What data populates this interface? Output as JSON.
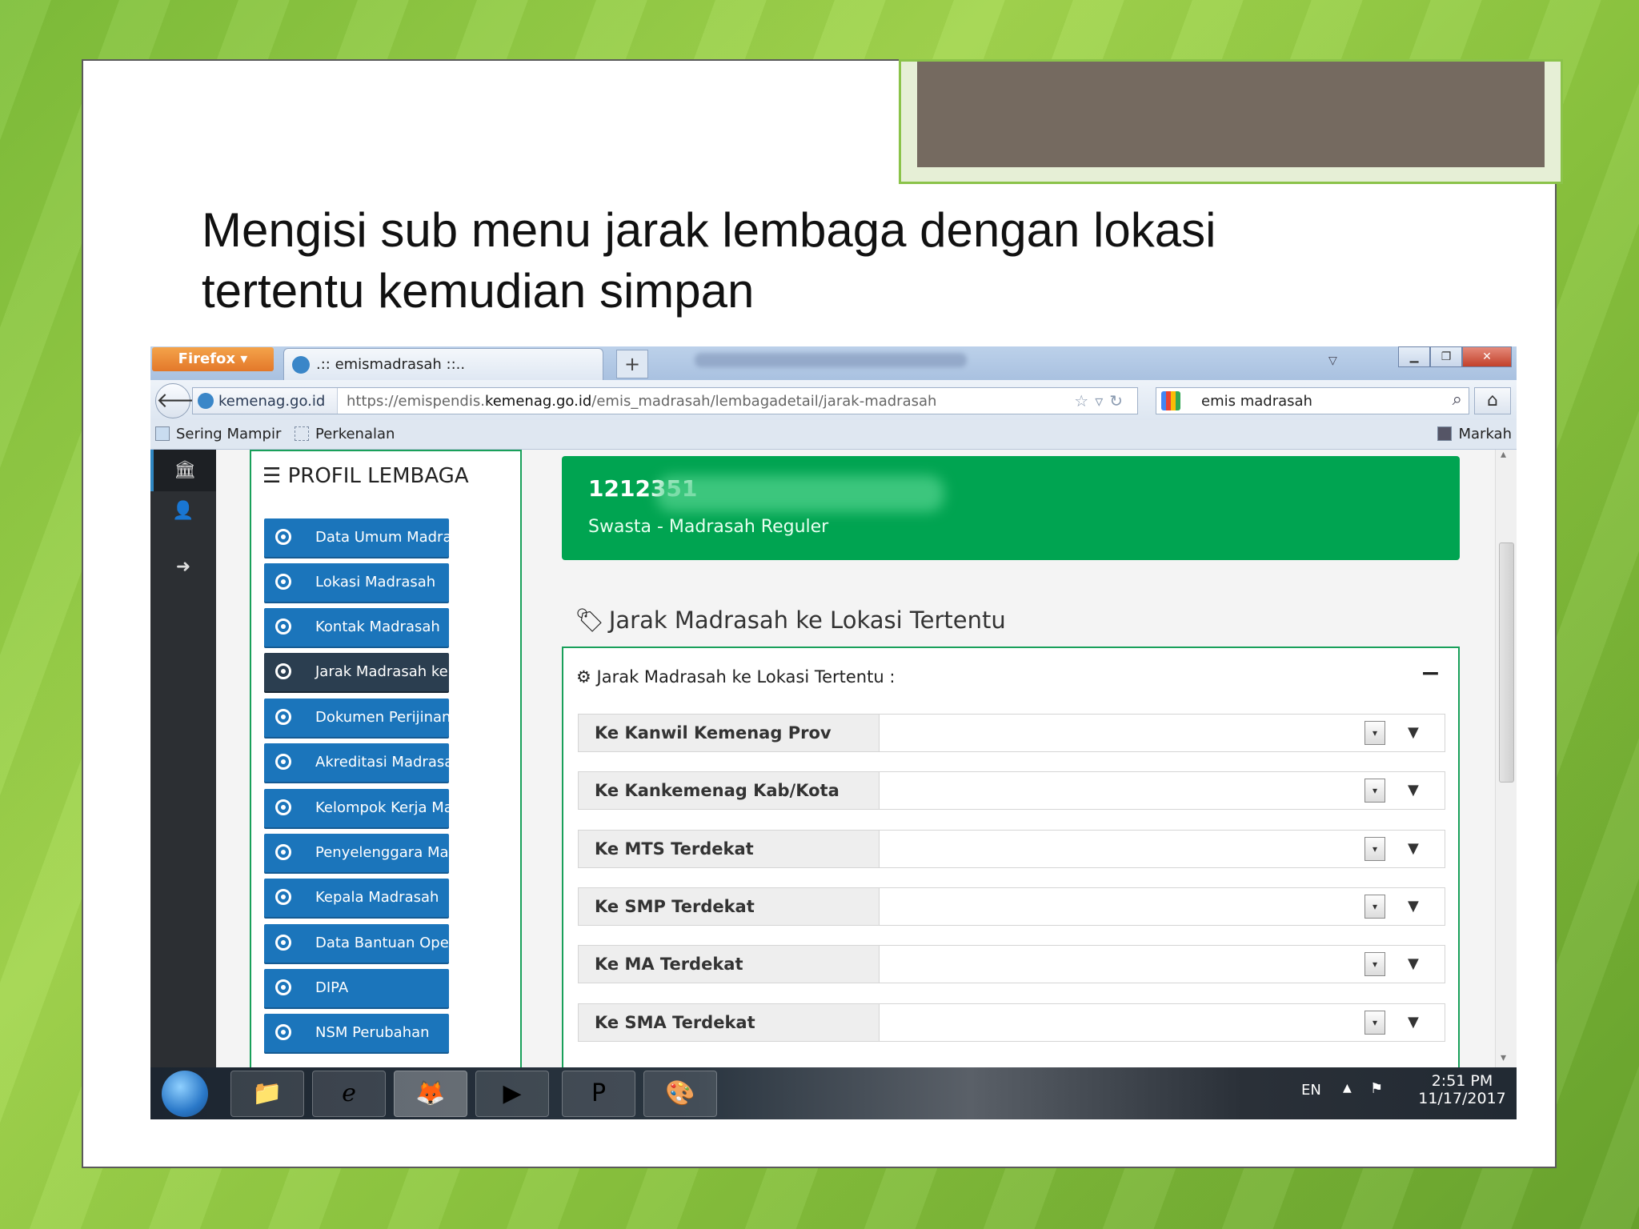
{
  "slide": {
    "heading_line1": "Mengisi sub menu jarak lembaga dengan lokasi",
    "heading_line2": "tertentu kemudian simpan"
  },
  "browser": {
    "firefox_menu": "Firefox",
    "tab_title": ".:: emismadrasah ::..",
    "new_tab": "+",
    "site_name": "kemenag.go.id",
    "url_prefix": "https://emispendis.",
    "url_domain": "kemenag.go.id",
    "url_path": "/emis_madrasah/lembagadetail/jarak-madrasah",
    "search_value": "emis madrasah",
    "bookmarks": [
      "Sering Mampir",
      "Perkenalan"
    ],
    "bookmarks_right": "Markah"
  },
  "sidebar_icons": [
    "bank-icon",
    "user-icon",
    "logout-icon"
  ],
  "profil": {
    "title": "PROFIL LEMBAGA",
    "menu": [
      "Data Umum Madrasah",
      "Lokasi Madrasah",
      "Kontak Madrasah",
      "Jarak Madrasah ke Lo...",
      "Dokumen Perijinan & ...",
      "Akreditasi Madrasah",
      "Kelompok Kerja Madr...",
      "Penyelenggara Madra...",
      "Kepala Madrasah",
      "Data Bantuan Operasi...",
      "DIPA",
      "NSM Perubahan"
    ],
    "active_index": 3
  },
  "institution": {
    "id": "1212351",
    "type": "Swasta - Madrasah Reguler"
  },
  "section": {
    "title": "Jarak Madrasah ke Lokasi Tertentu",
    "panel_title": "Jarak Madrasah ke Lokasi Tertentu :",
    "collapse": "−",
    "fields": [
      {
        "label": "Ke Kanwil Kemenag Prov",
        "value": ""
      },
      {
        "label": "Ke Kankemenag Kab/Kota",
        "value": ""
      },
      {
        "label": "Ke MTS Terdekat",
        "value": ""
      },
      {
        "label": "Ke SMP Terdekat",
        "value": ""
      },
      {
        "label": "Ke MA Terdekat",
        "value": ""
      },
      {
        "label": "Ke SMA Terdekat",
        "value": ""
      }
    ]
  },
  "taskbar": {
    "lang": "EN",
    "time": "2:51 PM",
    "date": "11/17/2017"
  },
  "colors": {
    "primary_blue": "#1b75bb",
    "active_dark": "#2b3e50",
    "green": "#00a451"
  }
}
